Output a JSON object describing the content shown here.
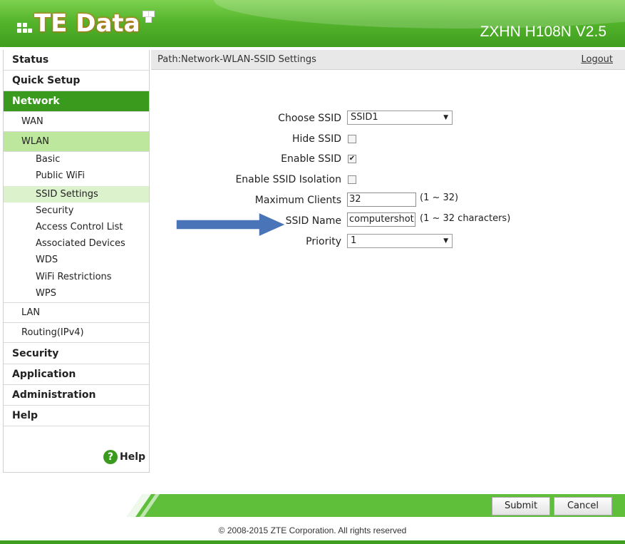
{
  "header": {
    "logo": "TE Data",
    "model": "ZXHN H108N V2.5"
  },
  "nav": {
    "status": "Status",
    "quick_setup": "Quick Setup",
    "network": "Network",
    "wan": "WAN",
    "wlan": "WLAN",
    "basic": "Basic",
    "public_wifi": "Public WiFi",
    "ssid_settings": "SSID Settings",
    "security_sub": "Security",
    "acl": "Access Control List",
    "associated": "Associated Devices",
    "wds": "WDS",
    "wifi_restrictions": "WiFi Restrictions",
    "wps": "WPS",
    "lan": "LAN",
    "routing": "Routing(IPv4)",
    "security": "Security",
    "application": "Application",
    "administration": "Administration",
    "help_main": "Help",
    "help_link": "Help",
    "help_glyph": "?"
  },
  "pathbar": {
    "path": "Path:Network-WLAN-SSID Settings",
    "logout": "Logout"
  },
  "form": {
    "choose_ssid_label": "Choose SSID",
    "choose_ssid_value": "SSID1",
    "hide_ssid_label": "Hide SSID",
    "hide_ssid_checked": false,
    "enable_ssid_label": "Enable SSID",
    "enable_ssid_checked": true,
    "enable_ssid_mark": "✔",
    "isolation_label": "Enable SSID Isolation",
    "isolation_checked": false,
    "max_clients_label": "Maximum Clients",
    "max_clients_value": "32",
    "max_clients_hint": "(1 ~ 32)",
    "ssid_name_label": "SSID Name",
    "ssid_name_value": "computershot",
    "ssid_name_hint": "(1 ~ 32 characters)",
    "priority_label": "Priority",
    "priority_value": "1",
    "select_arrow": "▼"
  },
  "footer": {
    "submit": "Submit",
    "cancel": "Cancel",
    "copyright": "© 2008-2015 ZTE Corporation. All rights reserved"
  },
  "colors": {
    "brand_green": "#3a9a1e",
    "logo_orange": "#e8501a",
    "arrow_blue": "#4a74b8"
  }
}
